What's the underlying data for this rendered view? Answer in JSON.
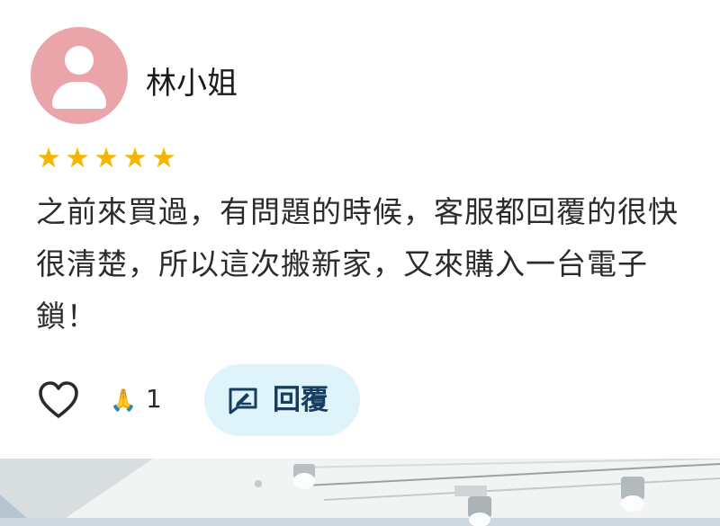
{
  "review": {
    "user_name": "林小姐",
    "rating": 5,
    "rating_max": 5,
    "stars": [
      "★",
      "★",
      "★",
      "★",
      "★"
    ],
    "text": "之前來買過，有問題的時候，客服都回覆的很快很清楚，所以這次搬新家，又來購入一台電子鎖！",
    "pray_emoji": "🙏",
    "pray_count": "1",
    "reply_label": "回覆"
  },
  "colors": {
    "avatar_bg": "#eaa5aa",
    "star": "#f7b500",
    "reply_bg": "#dff3fa",
    "reply_text": "#173d63"
  },
  "icons": {
    "avatar": "person-icon",
    "like": "heart-outline-icon",
    "reaction": "pray-emoji-icon",
    "reply": "edit-box-icon"
  }
}
